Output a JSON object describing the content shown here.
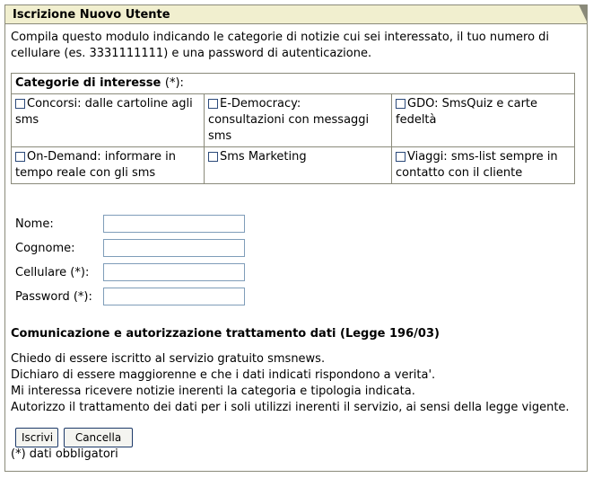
{
  "panel": {
    "title": "Iscrizione Nuovo Utente"
  },
  "intro": {
    "line1": "Compila questo modulo indicando le categorie di notizie cui sei interessato, il tuo numero di",
    "line2": "cellulare (es. 3331111111) e una password di autenticazione."
  },
  "categories": {
    "header": "Categorie di interesse",
    "required_mark": "(*):",
    "items": [
      {
        "line1": "Concorsi: dalle cartoline agli",
        "line2": "sms",
        "line3": ""
      },
      {
        "line1": "E-Democracy:",
        "line2": "consultazioni con messaggi",
        "line3": "sms"
      },
      {
        "line1": "GDO: SmsQuiz e carte",
        "line2": "fedeltà",
        "line3": ""
      },
      {
        "line1": "On-Demand: informare in",
        "line2": "tempo reale con gli sms",
        "line3": ""
      },
      {
        "line1": "Sms Marketing",
        "line2": "",
        "line3": ""
      },
      {
        "line1": "Viaggi: sms-list sempre in",
        "line2": "contatto con il cliente",
        "line3": ""
      }
    ]
  },
  "form": {
    "nome_label": "Nome:",
    "nome_value": "",
    "cognome_label": "Cognome:",
    "cognome_value": "",
    "cellulare_label": "Cellulare (*):",
    "cellulare_value": "",
    "password_label": "Password (*):",
    "password_value": ""
  },
  "privacy": {
    "title": "Comunicazione e autorizzazione trattamento dati (Legge 196/03)",
    "line1": "Chiedo di essere iscritto al servizio gratuito smsnews.",
    "line2": "Dichiaro di essere maggiorenne e che i dati indicati rispondono a verita'.",
    "line3": "Mi interessa ricevere notizie inerenti la categoria e tipologia indicata.",
    "line4": "Autorizzo il trattamento dei dati per i soli utilizzi inerenti il servizio, ai sensi della legge vigente."
  },
  "buttons": {
    "submit": "Iscrivi",
    "cancel": "Cancella"
  },
  "footnote": "(*) dati obbligatori",
  "colors": {
    "title_bg": "#f1efcf",
    "border": "#8a8a7a",
    "input_border": "#7f9db9",
    "checkbox_border": "#2c4a7a"
  }
}
